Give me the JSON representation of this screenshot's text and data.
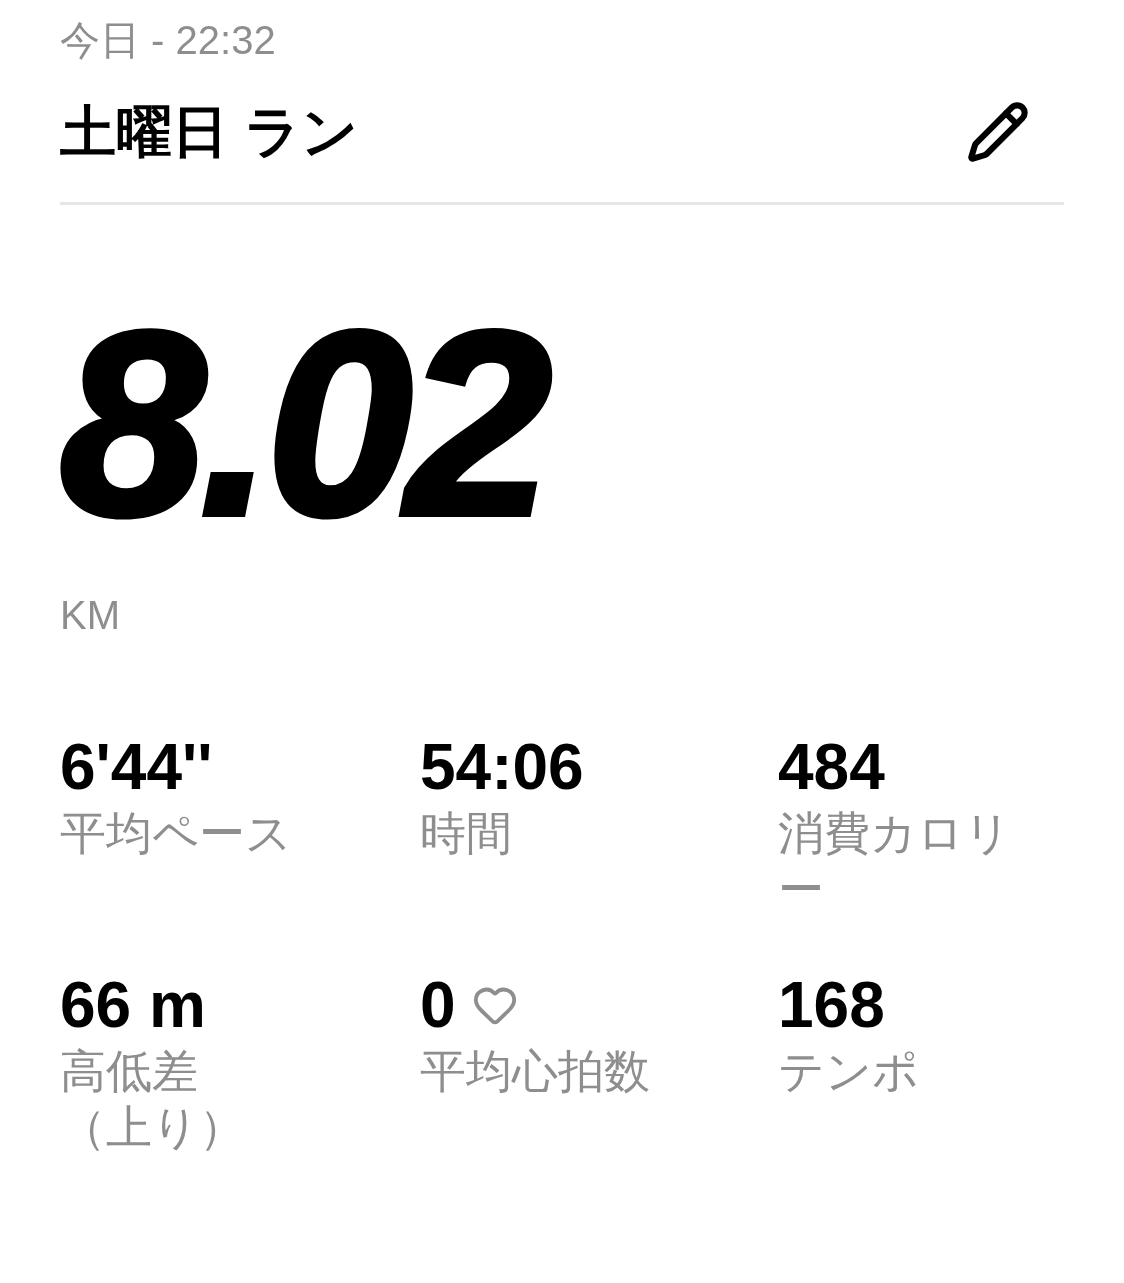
{
  "header": {
    "timestamp": "今日 - 22:32",
    "title": "土曜日 ラン"
  },
  "distance": {
    "value": "8.02",
    "unit": "KM"
  },
  "stats": [
    {
      "value": "6'44''",
      "label": [
        "平均ペース"
      ],
      "heart": false
    },
    {
      "value": "54:06",
      "label": [
        "時間"
      ],
      "heart": false
    },
    {
      "value": "484",
      "label": [
        "消費カロリー"
      ],
      "heart": false
    },
    {
      "value": "66 m",
      "label": [
        "高低差",
        "（上り）"
      ],
      "heart": false
    },
    {
      "value": "0",
      "label": [
        "平均心拍数"
      ],
      "heart": true
    },
    {
      "value": "168",
      "label": [
        "テンポ"
      ],
      "heart": false
    }
  ]
}
